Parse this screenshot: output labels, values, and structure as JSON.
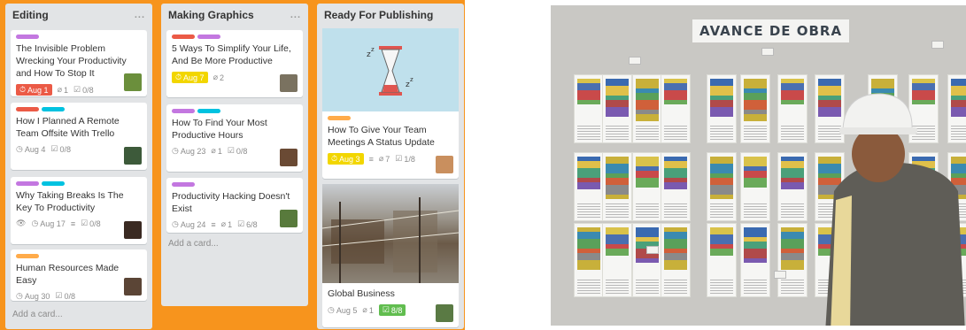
{
  "colors": {
    "board_bg": "#f7941d",
    "list_bg": "#e2e4e6",
    "purple": "#c377e0",
    "green": "#61bd4f",
    "red": "#eb5a46",
    "blue": "#00c2e0",
    "orange": "#ffab4a",
    "yellow": "#f2d600"
  },
  "lists": [
    {
      "title": "Editing",
      "menu": "...",
      "add_card": "Add a card...",
      "cards": [
        {
          "title": "The Invisible Problem Wrecking Your Productivity and How To Stop It",
          "due": "Aug 1",
          "attachments": "1",
          "checklist": "0/8"
        },
        {
          "title": "How I Planned A Remote Team Offsite With Trello",
          "due": "Aug 4",
          "checklist": "0/8"
        },
        {
          "title": "Why Taking Breaks Is The Key To Productivity",
          "due": "Aug 17",
          "checklist": "0/8"
        },
        {
          "title": "Human Resources Made Easy",
          "due": "Aug 30",
          "checklist": "0/8"
        }
      ]
    },
    {
      "title": "Making Graphics",
      "menu": "...",
      "add_card": "Add a card...",
      "cards": [
        {
          "title": "5 Ways To Simplify Your Life, And Be More Productive",
          "due": "Aug 7",
          "attachments": "2"
        },
        {
          "title": "How To Find Your Most Productive Hours",
          "due": "Aug 23",
          "attachments": "1",
          "checklist": "0/8"
        },
        {
          "title": "Productivity Hacking Doesn't Exist",
          "due": "Aug 24",
          "attachments": "1",
          "checklist": "6/8"
        }
      ]
    },
    {
      "title": "Ready For Publishing",
      "cards": [
        {
          "title": "How To Give Your Team Meetings A Status Update",
          "due": "Aug 3",
          "attachments": "7",
          "checklist": "1/8"
        },
        {
          "title": "Global Business",
          "due": "Aug 5",
          "attachments": "1",
          "checklist": "8/8"
        }
      ]
    }
  ],
  "photo": {
    "sign_text": "AVANCE DE OBRA"
  }
}
